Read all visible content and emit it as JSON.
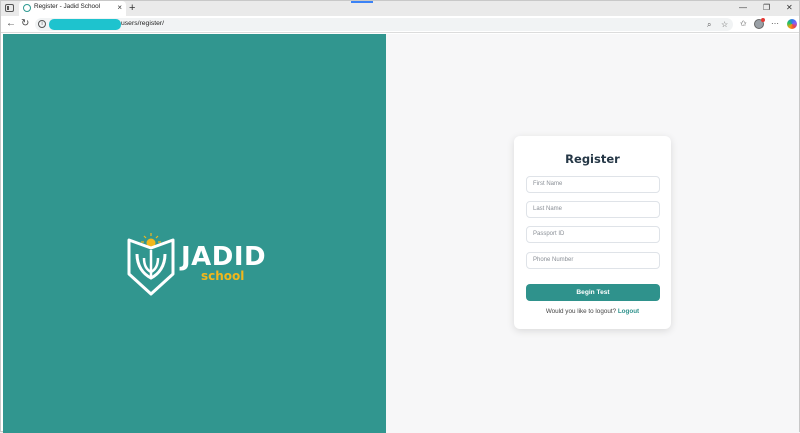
{
  "browser": {
    "tab": {
      "title": "Register - Jadid School",
      "close": "×",
      "new_tab": "+"
    },
    "controls": {
      "minimize": "—",
      "maximize": "❐",
      "close": "✕"
    },
    "nav": {
      "back": "←",
      "reload": "↻"
    },
    "address": {
      "url": "users/register/",
      "info": "i"
    },
    "actions": {
      "zoom": "⌕",
      "star": "☆",
      "favorites": "✩",
      "more": "⋯"
    }
  },
  "brand": {
    "name": "JADID",
    "sub": "school",
    "colors": {
      "primary": "#31968f",
      "accent": "#f2b71b"
    }
  },
  "form": {
    "title": "Register",
    "fields": {
      "first_name": {
        "placeholder": "First Name"
      },
      "last_name": {
        "placeholder": "Last Name"
      },
      "passport": {
        "placeholder": "Passport ID"
      },
      "phone": {
        "placeholder": "Phone Number"
      }
    },
    "submit_label": "Begin Test",
    "logout_prompt": "Would you like to logout?",
    "logout_link": "Logout"
  }
}
